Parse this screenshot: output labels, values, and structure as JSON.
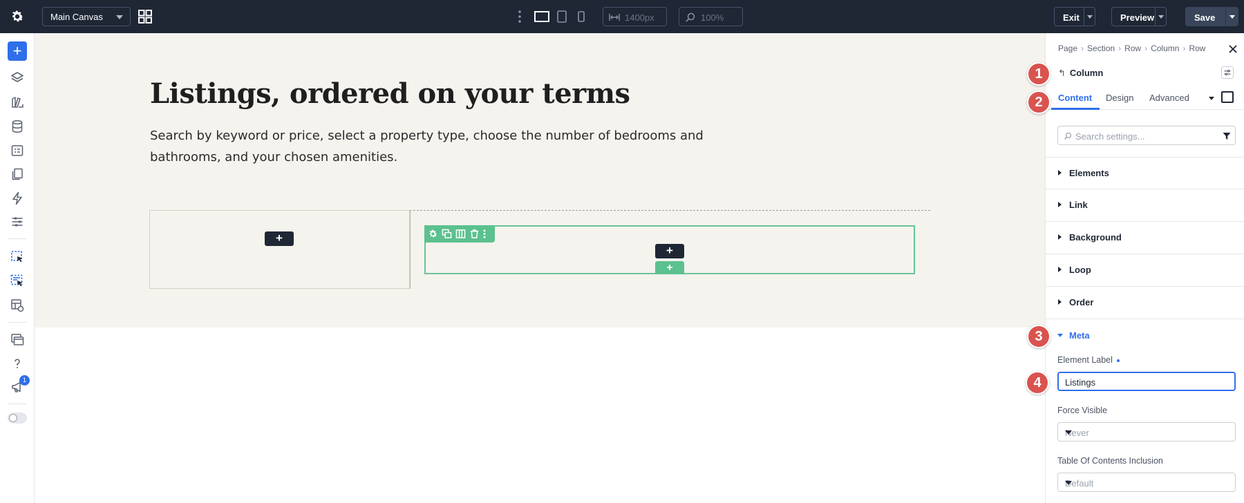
{
  "topbar": {
    "canvas_select": "Main Canvas",
    "width_value": "1400px",
    "zoom_value": "100%",
    "exit_label": "Exit",
    "preview_label": "Preview",
    "save_label": "Save"
  },
  "leftbar": {
    "add_label": "+",
    "notification_count": "1",
    "icons": [
      "layers-icon",
      "presets-icon",
      "database-icon",
      "form-icon",
      "pages-icon",
      "lightning-icon",
      "sliders-icon",
      "cursor-select-icon",
      "multi-select-icon",
      "library-icon",
      "windows-icon",
      "help-icon",
      "announcement-icon",
      "toggle-icon"
    ]
  },
  "canvas": {
    "heading": "Listings, ordered on your terms",
    "subtext": "Search by keyword or price, select a property type, choose the number of bedrooms and bathrooms, and your chosen amenities.",
    "add_symbol": "+",
    "accent_color": "#5bc18e"
  },
  "panel": {
    "breadcrumb": [
      "Page",
      "Section",
      "Row",
      "Column",
      "Row"
    ],
    "element_title": "Column",
    "tabs": [
      "Content",
      "Design",
      "Advanced"
    ],
    "search_placeholder": "Search settings...",
    "groups": [
      "Elements",
      "Link",
      "Background",
      "Loop",
      "Order"
    ],
    "expanded_group": "Meta",
    "fields": {
      "element_label": {
        "label": "Element Label",
        "value": "Listings"
      },
      "force_visible": {
        "label": "Force Visible",
        "value": "Never"
      },
      "toc_inclusion": {
        "label": "Table Of Contents Inclusion",
        "value": "Default"
      }
    },
    "accent_color": "#2f6fea"
  },
  "callouts": [
    "1",
    "2",
    "3",
    "4"
  ]
}
